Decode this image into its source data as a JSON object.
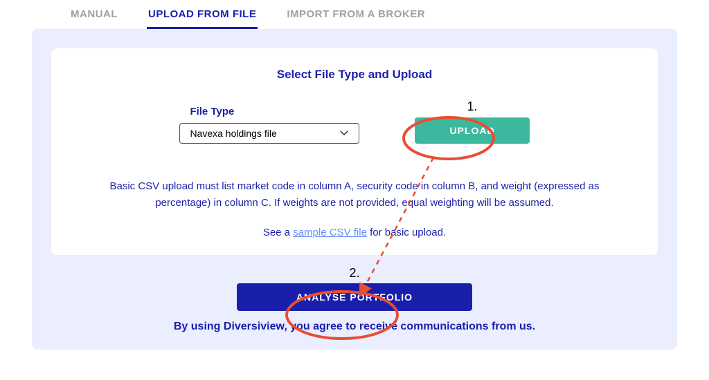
{
  "tabs": {
    "manual": "MANUAL",
    "upload": "UPLOAD FROM FILE",
    "import": "IMPORT FROM A BROKER"
  },
  "card": {
    "title": "Select File Type and Upload",
    "fileTypeLabel": "File Type",
    "fileTypeSelected": "Navexa holdings file",
    "uploadLabel": "UPLOAD",
    "note": "Basic CSV upload must list market code in column A, security code in column B, and weight (expressed as percentage) in column C. If weights are not provided, equal weighting will be assumed.",
    "samplePrefix": "See a ",
    "sampleLink": "sample CSV file",
    "sampleSuffix": " for basic upload."
  },
  "steps": {
    "one": "1.",
    "two": "2."
  },
  "analyseLabel": "ANALYSE PORTFOLIO",
  "consent": "By using Diversiview, you agree to receive communications from us.",
  "annot": {
    "circleColor": "#e84e34"
  }
}
